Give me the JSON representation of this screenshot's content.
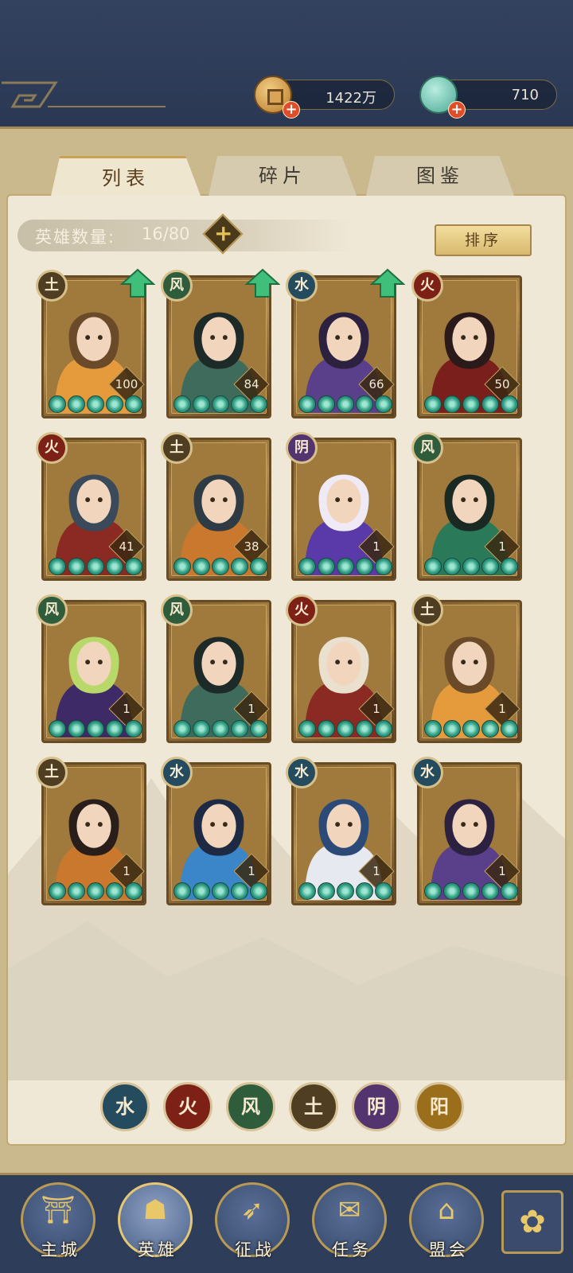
{
  "resources": {
    "coin": {
      "value": "1422万",
      "icon": "copper-coin-icon"
    },
    "jade": {
      "value": "710",
      "icon": "jade-shell-icon"
    }
  },
  "tabs": [
    {
      "label": "列表",
      "active": true
    },
    {
      "label": "碎片",
      "active": false
    },
    {
      "label": "图鉴",
      "active": false
    }
  ],
  "hero_count": {
    "label": "英雄数量:",
    "value": "16/80"
  },
  "sort_label": "排序",
  "elements": {
    "soil": "土",
    "wind": "风",
    "water": "水",
    "fire": "火",
    "yin": "阴",
    "yang": "阳"
  },
  "heroes": [
    {
      "element": "土",
      "level": "100",
      "stars": 5,
      "upgradable": true
    },
    {
      "element": "风",
      "level": "84",
      "stars": 5,
      "upgradable": true
    },
    {
      "element": "水",
      "level": "66",
      "stars": 5,
      "upgradable": true
    },
    {
      "element": "火",
      "level": "50",
      "stars": 5,
      "upgradable": false
    },
    {
      "element": "火",
      "level": "41",
      "stars": 5,
      "upgradable": false
    },
    {
      "element": "土",
      "level": "38",
      "stars": 5,
      "upgradable": false
    },
    {
      "element": "阴",
      "level": "1",
      "stars": 5,
      "upgradable": false
    },
    {
      "element": "风",
      "level": "1",
      "stars": 5,
      "upgradable": false
    },
    {
      "element": "风",
      "level": "1",
      "stars": 5,
      "upgradable": false
    },
    {
      "element": "风",
      "level": "1",
      "stars": 5,
      "upgradable": false
    },
    {
      "element": "火",
      "level": "1",
      "stars": 5,
      "upgradable": false
    },
    {
      "element": "土",
      "level": "1",
      "stars": 5,
      "upgradable": false
    },
    {
      "element": "土",
      "level": "1",
      "stars": 5,
      "upgradable": false
    },
    {
      "element": "水",
      "level": "1",
      "stars": 5,
      "upgradable": false
    },
    {
      "element": "水",
      "level": "1",
      "stars": 5,
      "upgradable": false
    },
    {
      "element": "水",
      "level": "1",
      "stars": 5,
      "upgradable": false
    }
  ],
  "element_filters": [
    "水",
    "火",
    "风",
    "土",
    "阴",
    "阳"
  ],
  "nav": [
    {
      "label": "主城",
      "icon": "palace-icon",
      "active": false
    },
    {
      "label": "英雄",
      "icon": "hero-portrait-icon",
      "active": true
    },
    {
      "label": "征战",
      "icon": "battle-boot-icon",
      "active": false
    },
    {
      "label": "任务",
      "icon": "scroll-bell-icon",
      "active": false
    },
    {
      "label": "盟会",
      "icon": "pavilion-icon",
      "active": false
    }
  ],
  "nav_menu_icon": "flower-menu-icon"
}
